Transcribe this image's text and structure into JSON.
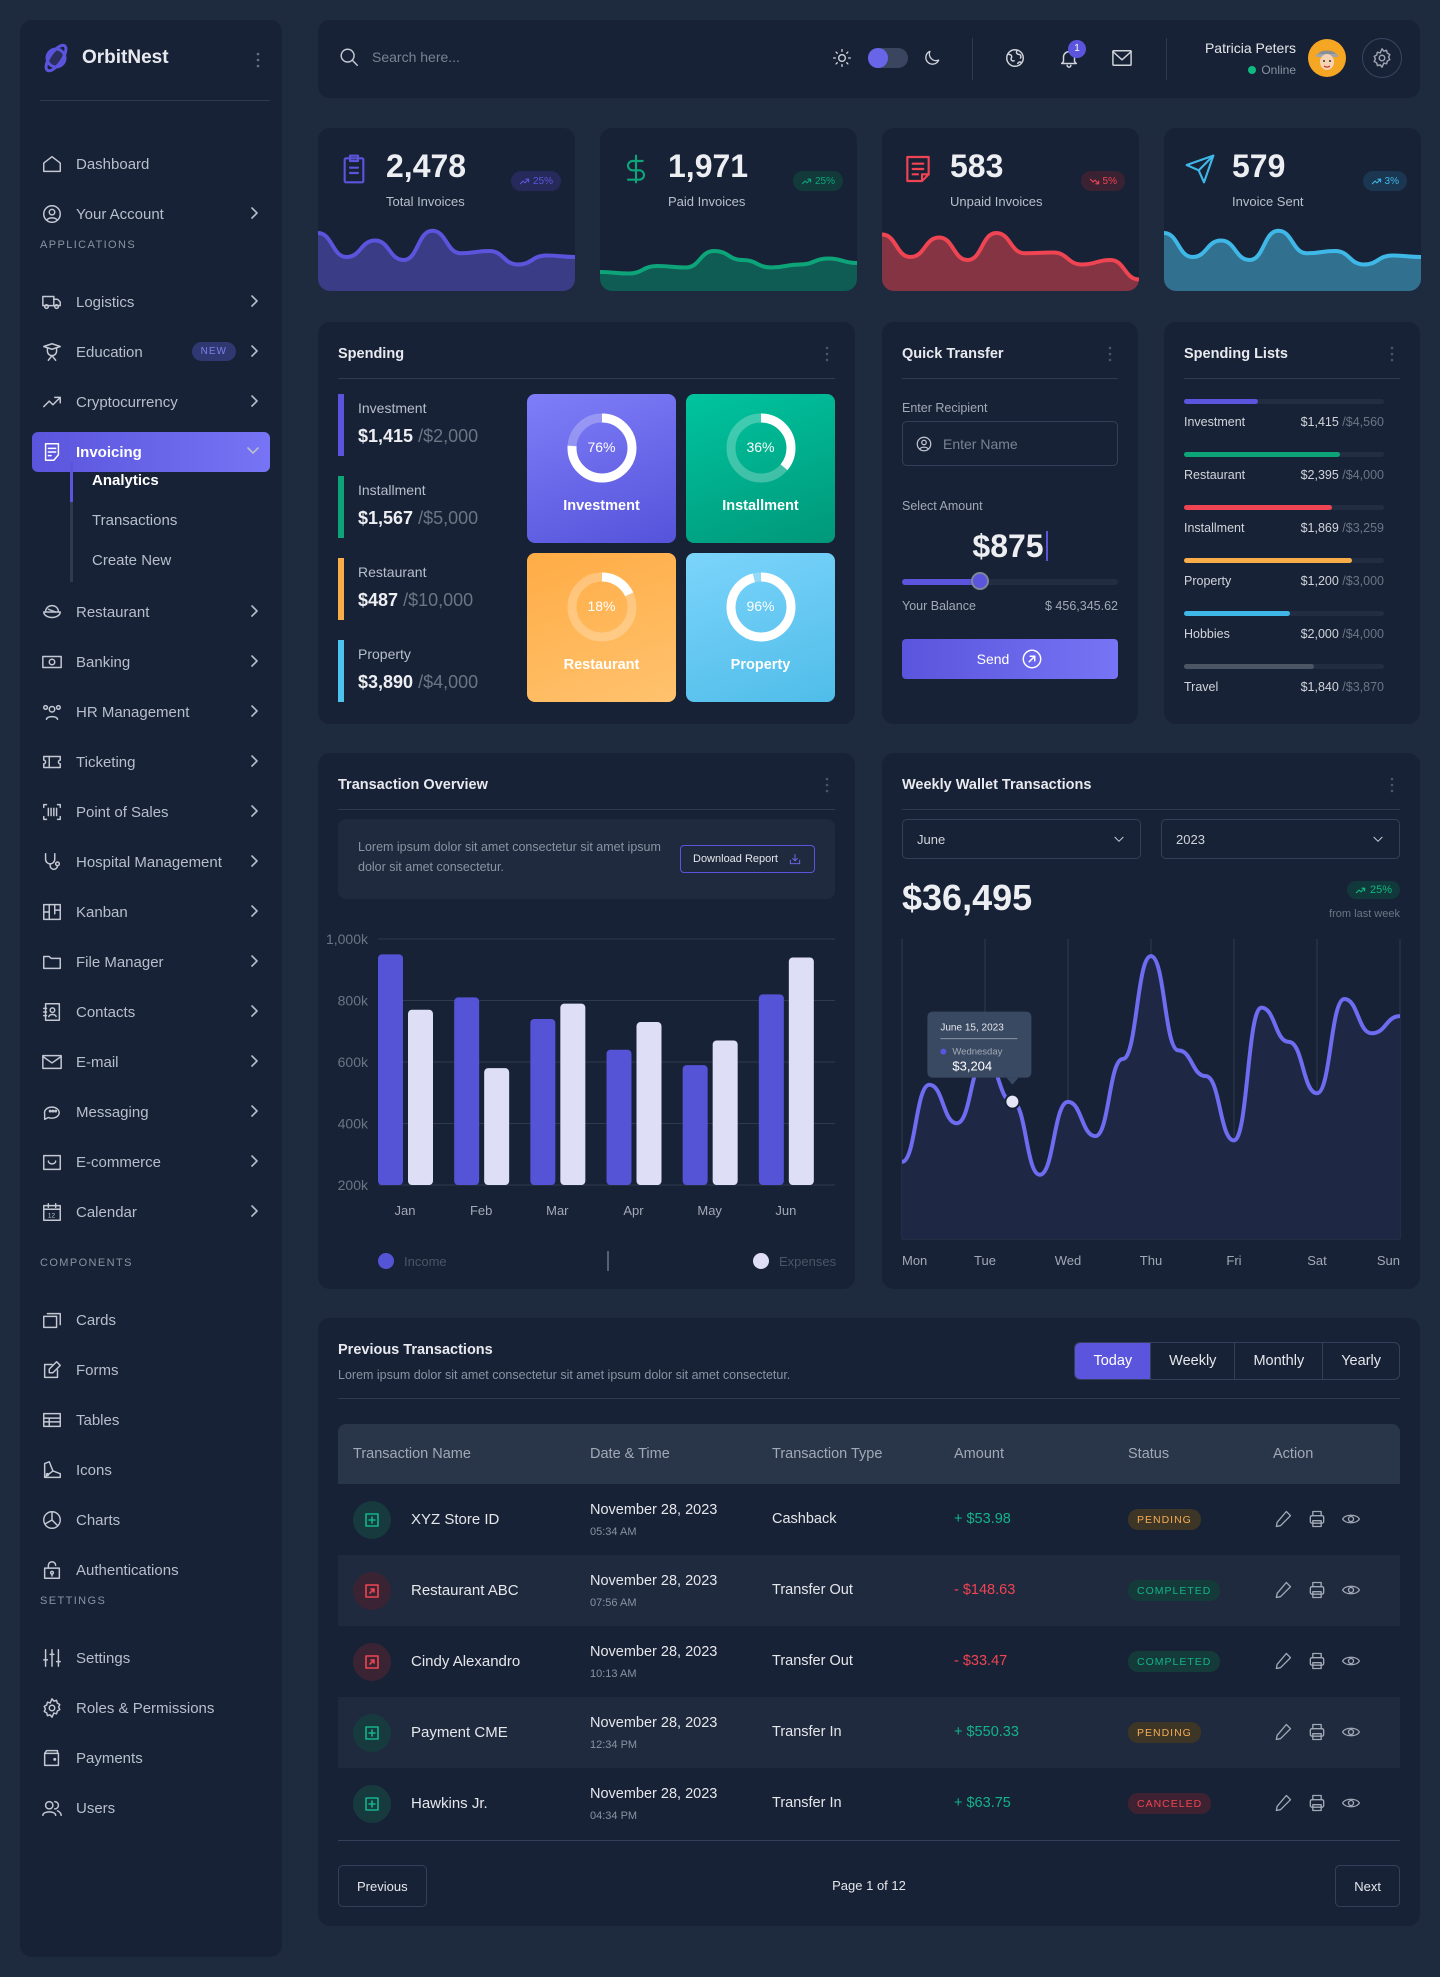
{
  "brand": {
    "name": "OrbitNest",
    "accent": "#5a55dc"
  },
  "sidebar": {
    "top_items": [
      {
        "label": "Dashboard",
        "icon": "home-icon"
      },
      {
        "label": "Your Account",
        "icon": "user-circle-icon"
      }
    ],
    "section_applications": "APPLICATIONS",
    "applications": [
      {
        "label": "Logistics",
        "icon": "truck-icon"
      },
      {
        "label": "Education",
        "icon": "graduation-icon",
        "badge": "NEW"
      },
      {
        "label": "Cryptocurrency",
        "icon": "trend-icon"
      },
      {
        "label": "Invoicing",
        "icon": "invoice-icon",
        "active": true
      }
    ],
    "invoicing_sub": [
      {
        "label": "Analytics",
        "active": true
      },
      {
        "label": "Transactions"
      },
      {
        "label": "Create New"
      }
    ],
    "more_apps": [
      {
        "label": "Restaurant",
        "icon": "bowl-icon"
      },
      {
        "label": "Banking",
        "icon": "banknote-icon"
      },
      {
        "label": "HR Management",
        "icon": "users-group-icon"
      },
      {
        "label": "Ticketing",
        "icon": "ticket-icon"
      },
      {
        "label": "Point of Sales",
        "icon": "barcode-icon"
      },
      {
        "label": "Hospital Management",
        "icon": "stethoscope-icon"
      },
      {
        "label": "Kanban",
        "icon": "kanban-icon"
      },
      {
        "label": "File Manager",
        "icon": "folder-icon"
      },
      {
        "label": "Contacts",
        "icon": "contact-book-icon"
      },
      {
        "label": "E-mail",
        "icon": "mail-icon"
      },
      {
        "label": "Messaging",
        "icon": "chat-icon"
      },
      {
        "label": "E-commerce",
        "icon": "shop-icon"
      },
      {
        "label": "Calendar",
        "icon": "calendar-icon"
      }
    ],
    "section_components": "COMPONENTS",
    "components": [
      {
        "label": "Cards",
        "icon": "cards-icon"
      },
      {
        "label": "Forms",
        "icon": "edit-icon"
      },
      {
        "label": "Tables",
        "icon": "table-icon"
      },
      {
        "label": "Icons",
        "icon": "swatch-icon"
      },
      {
        "label": "Charts",
        "icon": "pie-chart-icon"
      },
      {
        "label": "Authentications",
        "icon": "lock-icon"
      }
    ],
    "section_settings": "SETTINGS",
    "settings": [
      {
        "label": "Settings",
        "icon": "sliders-icon"
      },
      {
        "label": "Roles & Permissions",
        "icon": "gear-icon"
      },
      {
        "label": "Payments",
        "icon": "wallet-icon"
      },
      {
        "label": "Users",
        "icon": "users-icon"
      }
    ]
  },
  "header": {
    "search_placeholder": "Search here...",
    "notification_count": "1",
    "user_name": "Patricia Peters",
    "user_status": "Online"
  },
  "stats": [
    {
      "value": "2,478",
      "label": "Total Invoices",
      "change": "25%",
      "trend": "up",
      "color": "#5a55dc",
      "fill": "#3a3c85",
      "pill_bg": "#262a5a",
      "spark": [
        72,
        40,
        62,
        36,
        75,
        45,
        48,
        30,
        42,
        40
      ]
    },
    {
      "value": "1,971",
      "label": "Paid Invoices",
      "change": "25%",
      "trend": "up",
      "color": "#0ea47a",
      "fill": "#0e5c54",
      "pill_bg": "#123a3a",
      "spark": [
        20,
        18,
        28,
        26,
        48,
        36,
        26,
        30,
        38,
        32
      ]
    },
    {
      "value": "583",
      "label": "Unpaid Invoices",
      "change": "5%",
      "trend": "down",
      "color": "#ef4452",
      "fill": "#843443",
      "pill_bg": "#3a2232",
      "spark": [
        70,
        40,
        66,
        36,
        72,
        45,
        46,
        30,
        36,
        10
      ]
    },
    {
      "value": "579",
      "label": "Invoice Sent",
      "change": "3%",
      "trend": "up",
      "color": "#3fb8e8",
      "fill": "#32708f",
      "pill_bg": "#1a3650",
      "spark": [
        72,
        40,
        62,
        36,
        75,
        45,
        48,
        30,
        42,
        40
      ]
    }
  ],
  "spending": {
    "title": "Spending",
    "items": [
      {
        "name": "Investment",
        "amount": "$1,415",
        "limit": "/$2,000",
        "color": "#5a55dc"
      },
      {
        "name": "Installment",
        "amount": "$1,567",
        "limit": "/$5,000",
        "color": "#0ea47a"
      },
      {
        "name": "Restaurant",
        "amount": "$487",
        "limit": "/$10,000",
        "color": "#f9ae4a"
      },
      {
        "name": "Property",
        "amount": "$3,890",
        "limit": "/$4,000",
        "color": "#4fc3ef"
      }
    ],
    "tiles": [
      {
        "name": "Investment",
        "percent": 76,
        "bg": "linear-gradient(160deg,#7f7ef8,#5553da)"
      },
      {
        "name": "Installment",
        "percent": 36,
        "bg": "linear-gradient(160deg,#00c49f,#00987a)"
      },
      {
        "name": "Restaurant",
        "percent": 18,
        "bg": "linear-gradient(160deg,#ffac45,#ffc26e)"
      },
      {
        "name": "Property",
        "percent": 96,
        "bg": "linear-gradient(160deg,#7cd4fb,#4fbde9)"
      }
    ]
  },
  "quick_transfer": {
    "title": "Quick Transfer",
    "recipient_label": "Enter Recipient",
    "recipient_placeholder": "Enter Name",
    "amount_label": "Select Amount",
    "amount": "$875",
    "slider_fraction": 0.36,
    "balance_label": "Your Balance",
    "balance": "$ 456,345.62",
    "send_label": "Send"
  },
  "spending_lists": {
    "title": "Spending Lists",
    "items": [
      {
        "name": "Investment",
        "amount": "$1,415",
        "limit": "/$4,560",
        "fraction": 0.37,
        "color": "#5a55dc"
      },
      {
        "name": "Restaurant",
        "amount": "$2,395",
        "limit": "/$4,000",
        "fraction": 0.78,
        "color": "#0ea47a"
      },
      {
        "name": "Installment",
        "amount": "$1,869",
        "limit": "/$3,259",
        "fraction": 0.74,
        "color": "#ef4452"
      },
      {
        "name": "Property",
        "amount": "$1,200",
        "limit": "/$3,000",
        "fraction": 0.84,
        "color": "#f9ae4a"
      },
      {
        "name": "Hobbies",
        "amount": "$2,000",
        "limit": "/$4,000",
        "fraction": 0.53,
        "color": "#3fb8e8"
      },
      {
        "name": "Travel",
        "amount": "$1,840",
        "limit": "/$3,870",
        "fraction": 0.65,
        "color": "#4b5563"
      }
    ]
  },
  "overview": {
    "title": "Transaction Overview",
    "info": "Lorem ipsum dolor sit amet consectetur sit amet ipsum dolor sit amet consectetur.",
    "download_label": "Download Report"
  },
  "weekly": {
    "title": "Weekly Wallet Transactions",
    "month": "June",
    "year": "2023",
    "total": "$36,495",
    "change": "25%",
    "change_sub": "from last week",
    "tooltip": {
      "date": "June 15, 2023",
      "day": "Wednesday",
      "value": "$3,204"
    }
  },
  "chart_data": [
    {
      "type": "bar",
      "title": "Transaction Overview",
      "categories": [
        "Jan",
        "Feb",
        "Mar",
        "Apr",
        "May",
        "Jun"
      ],
      "series": [
        {
          "name": "Income",
          "color": "#5553d6",
          "values": [
            950,
            810,
            740,
            640,
            590,
            820
          ]
        },
        {
          "name": "Expenses",
          "color": "#dedff7",
          "values": [
            770,
            580,
            790,
            730,
            670,
            940
          ]
        }
      ],
      "ylim": [
        200,
        1000
      ],
      "yticks": [
        "200k",
        "400k",
        "600k",
        "800k",
        "1,000k"
      ],
      "ytick_values": [
        200,
        400,
        600,
        800,
        1000
      ],
      "grid": true,
      "legend": "bottom"
    },
    {
      "type": "area",
      "title": "Weekly Wallet Transactions",
      "categories": [
        "Mon",
        "Tue",
        "Wed",
        "Thu",
        "Fri",
        "Sat",
        "Sun"
      ],
      "x": [
        0,
        0.33,
        0.66,
        1,
        1.33,
        1.66,
        2,
        2.33,
        2.66,
        3,
        3.33,
        3.66,
        4,
        4.33,
        4.66,
        5,
        5.33,
        5.66,
        6
      ],
      "series": [
        {
          "name": "Wallet",
          "color": "#6e6cf0",
          "values": [
            1800,
            3600,
            2700,
            4200,
            3204,
            1500,
            3200,
            2400,
            4200,
            6600,
            4400,
            3800,
            2300,
            5400,
            4600,
            3400,
            5600,
            4800,
            5200
          ]
        }
      ],
      "ylim": [
        0,
        7000
      ],
      "highlight": {
        "label": "Wednesday",
        "value": 3204
      },
      "grid": true
    }
  ],
  "transactions": {
    "title": "Previous Transactions",
    "subtitle": "Lorem ipsum dolor sit amet consectetur sit amet ipsum dolor sit amet consectetur.",
    "filters": [
      "Today",
      "Weekly",
      "Monthly",
      "Yearly"
    ],
    "active_filter": "Today",
    "columns": [
      "Transaction Name",
      "Date & Time",
      "Transaction Type",
      "Amount",
      "Status",
      "Action"
    ],
    "rows": [
      {
        "name": "XYZ Store ID",
        "date": "November 28, 2023",
        "time": "05:34 AM",
        "type": "Cashback",
        "amount": "+ $53.98",
        "direction": "in",
        "status": "PENDING"
      },
      {
        "name": "Restaurant ABC",
        "date": "November 28, 2023",
        "time": "07:56 AM",
        "type": "Transfer Out",
        "amount": "- $148.63",
        "direction": "out",
        "status": "COMPLETED"
      },
      {
        "name": "Cindy Alexandro",
        "date": "November 28, 2023",
        "time": "10:13 AM",
        "type": "Transfer Out",
        "amount": "- $33.47",
        "direction": "out",
        "status": "COMPLETED"
      },
      {
        "name": "Payment CME",
        "date": "November 28, 2023",
        "time": "12:34 PM",
        "type": "Transfer In",
        "amount": "+ $550.33",
        "direction": "in",
        "status": "PENDING"
      },
      {
        "name": "Hawkins Jr.",
        "date": "November 28, 2023",
        "time": "04:34 PM",
        "type": "Transfer In",
        "amount": "+ $63.75",
        "direction": "in",
        "status": "CANCELED"
      }
    ],
    "previous_label": "Previous",
    "next_label": "Next",
    "page_info": "Page 1 of 12"
  }
}
